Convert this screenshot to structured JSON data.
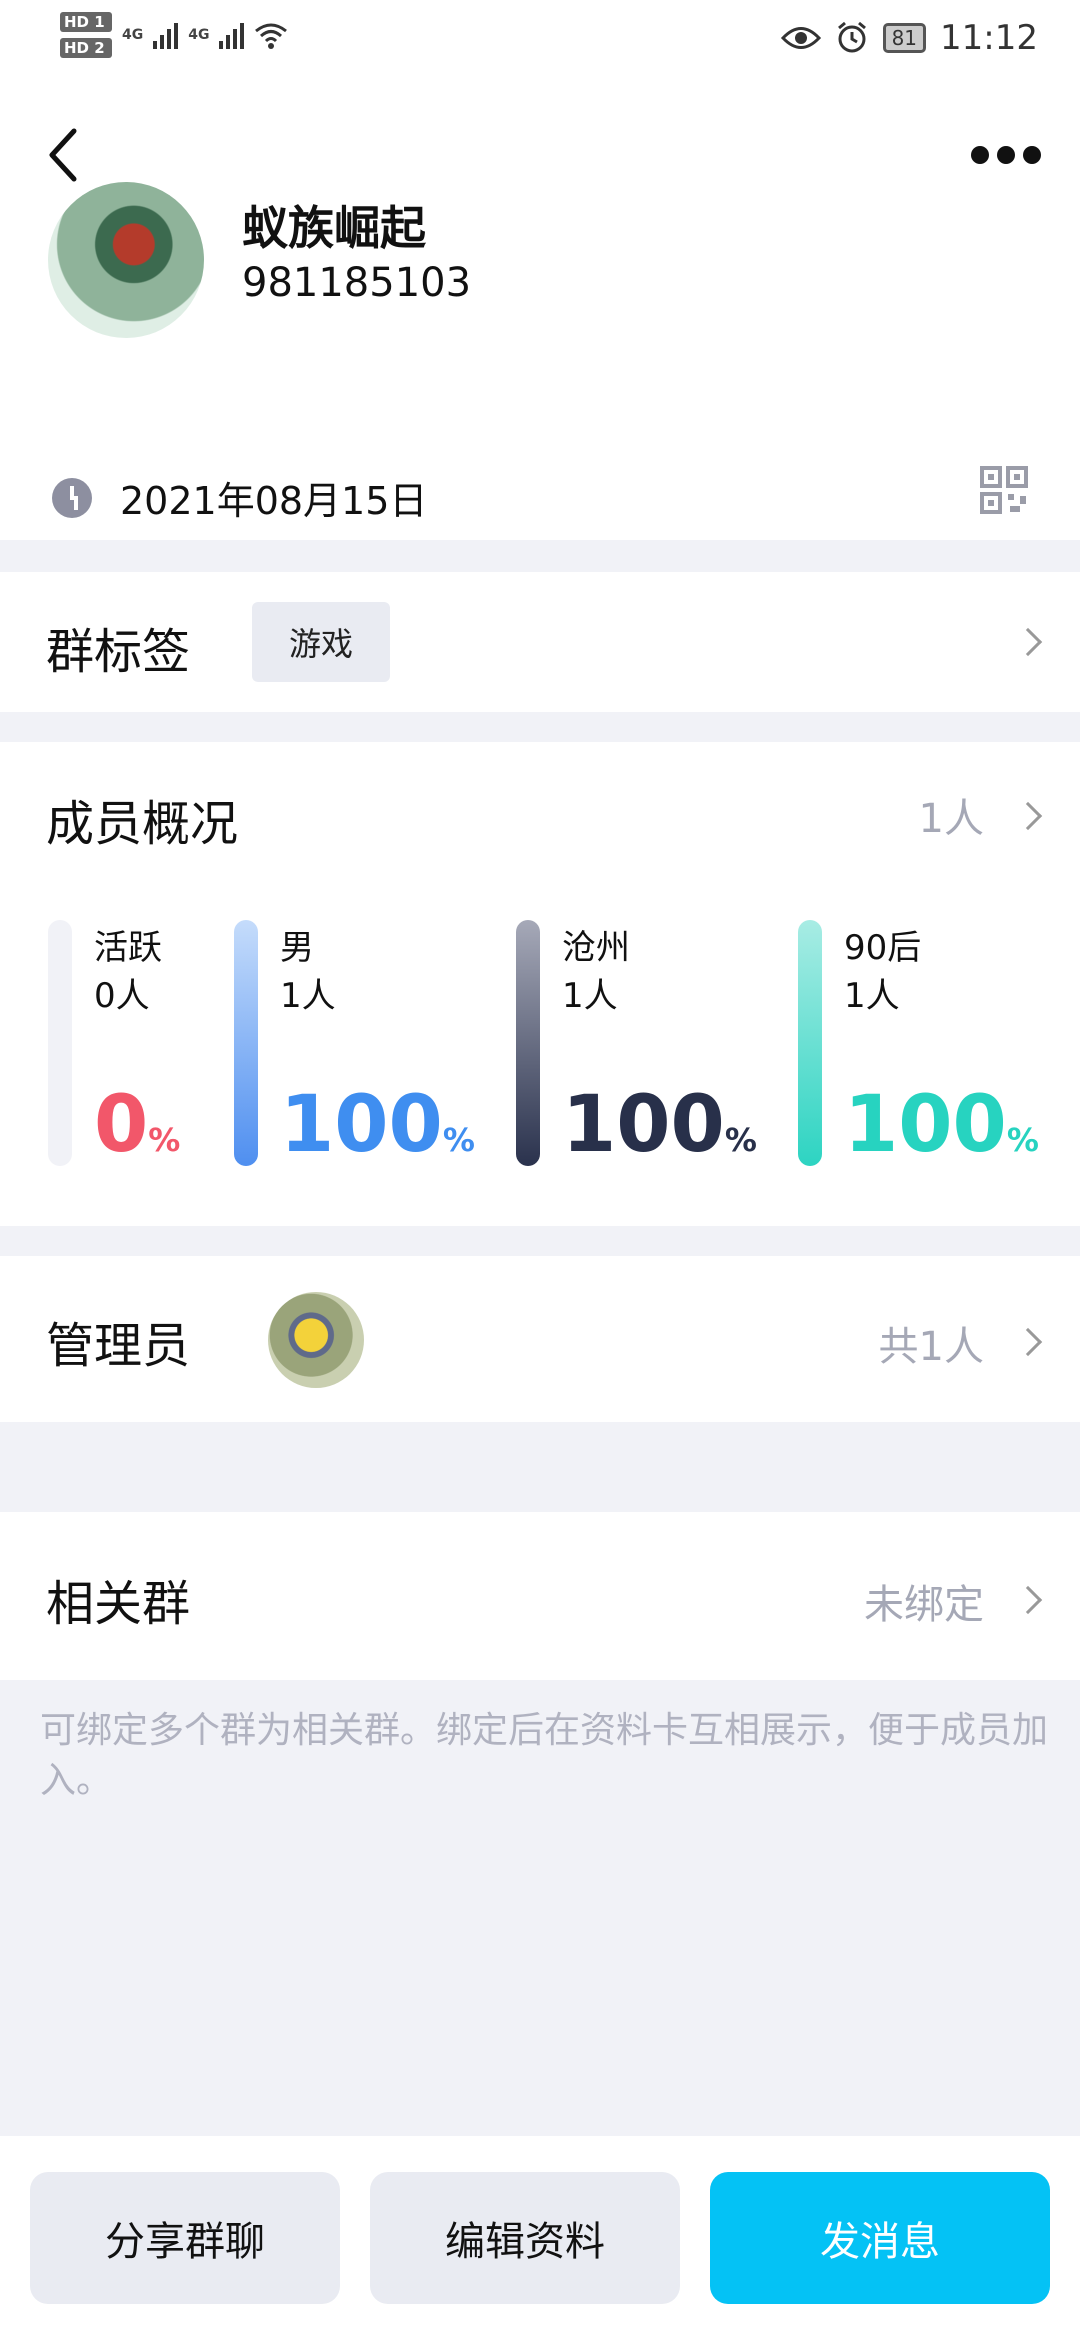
{
  "status_bar": {
    "hd1": "HD 1",
    "hd2": "HD 2",
    "sig1": "4G",
    "sig2": "4G",
    "battery": "81",
    "time": "11:12"
  },
  "group": {
    "name": "蚁族崛起",
    "id": "981185103",
    "created_date": "2021年08月15日"
  },
  "tags": {
    "title": "群标签",
    "items": [
      "游戏"
    ]
  },
  "members": {
    "title": "成员概况",
    "count": "1人",
    "stats": [
      {
        "label": "活跃",
        "count": "0人",
        "percent": "0",
        "unit": "%",
        "color": "#f1f2f7",
        "pct_color": "#f2576a",
        "fill": 0
      },
      {
        "label": "男",
        "count": "1人",
        "percent": "100",
        "unit": "%",
        "color": "#4f8ff0",
        "pct_color": "#3f8ef0",
        "fill": 1
      },
      {
        "label": "沧州",
        "count": "1人",
        "percent": "100",
        "unit": "%",
        "color": "#2a324d",
        "pct_color": "#28304a",
        "fill": 1
      },
      {
        "label": "90后",
        "count": "1人",
        "percent": "100",
        "unit": "%",
        "color": "#2dd4c2",
        "pct_color": "#27d3c0",
        "fill": 1
      }
    ]
  },
  "admins": {
    "title": "管理员",
    "total": "共1人"
  },
  "related": {
    "title": "相关群",
    "status": "未绑定",
    "note": "可绑定多个群为相关群。绑定后在资料卡互相展示，便于成员加入。"
  },
  "actions": {
    "share": "分享群聊",
    "edit": "编辑资料",
    "message": "发消息"
  },
  "colors": {
    "accent": "#04c2f5"
  }
}
